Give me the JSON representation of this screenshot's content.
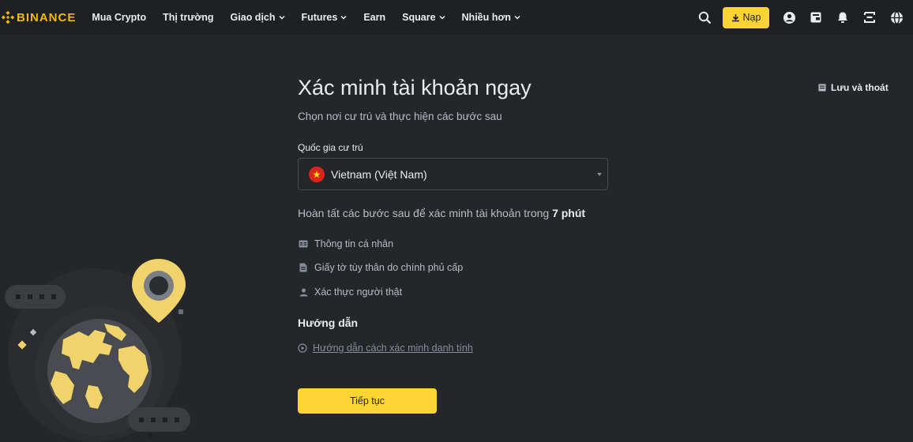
{
  "brand": {
    "name": "BINANCE",
    "color": "#F0B90B"
  },
  "nav": {
    "items": [
      {
        "label": "Mua Crypto",
        "has_caret": false
      },
      {
        "label": "Thị trường",
        "has_caret": false
      },
      {
        "label": "Giao dịch",
        "has_caret": true
      },
      {
        "label": "Futures",
        "has_caret": true
      },
      {
        "label": "Earn",
        "has_caret": false
      },
      {
        "label": "Square",
        "has_caret": true
      },
      {
        "label": "Nhiều hơn",
        "has_caret": true
      }
    ]
  },
  "toolbar": {
    "deposit_label": "Nạp",
    "icons": [
      "search-icon",
      "deposit-icon",
      "user-icon",
      "wallet-icon",
      "bell-icon",
      "download-app-icon",
      "globe-icon"
    ]
  },
  "page": {
    "title": "Xác minh tài khoản ngay",
    "subtitle": "Chọn nơi cư trú và thực hiện các bước sau",
    "save_exit_label": "Lưu và thoát",
    "country_label": "Quốc gia cư trú",
    "country_value": "Vietnam (Việt Nam)",
    "steps_intro_prefix": "Hoàn tất các bước sau để xác minh tài khoản trong",
    "steps_intro_time": "7 phút",
    "steps": [
      {
        "label": "Thông tin cá nhân",
        "icon": "id-card-icon"
      },
      {
        "label": "Giấy tờ tùy thân do chính phủ cấp",
        "icon": "document-icon"
      },
      {
        "label": "Xác thực người thật",
        "icon": "person-icon"
      }
    ],
    "guide_title": "Hướng dẫn",
    "guide_link": "Hướng dẫn cách xác minh danh tính",
    "continue_label": "Tiếp tục"
  },
  "colors": {
    "accent": "#FCD535",
    "background": "#252629",
    "topbar": "#1F2023"
  }
}
